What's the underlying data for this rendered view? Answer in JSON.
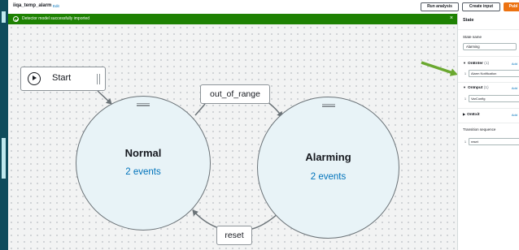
{
  "header": {
    "title": "iiqa_temp_alarm",
    "edit_label": "Edit",
    "buttons": {
      "run_analysis": "Run analysis",
      "create_input": "Create input",
      "publish": "Publ"
    }
  },
  "flash": {
    "message": "Detector model successfully imported",
    "close_glyph": "×"
  },
  "diagram": {
    "start_label": "Start",
    "states": [
      {
        "name": "Normal",
        "events": "2 events"
      },
      {
        "name": "Alarming",
        "events": "2 events"
      }
    ],
    "transitions": [
      {
        "label": "out_of_range"
      },
      {
        "label": "reset"
      }
    ]
  },
  "panel": {
    "title": "State",
    "state_name_label": "State name",
    "state_name_value": "Alarming",
    "sections": {
      "on_enter": {
        "label": "OnEnter",
        "count": "(1)",
        "add": "Add",
        "rows": [
          {
            "index": "1",
            "value": "Alarm Notification"
          }
        ]
      },
      "on_input": {
        "label": "OnInput",
        "count": "(1)",
        "add": "Add",
        "rows": [
          {
            "index": "1",
            "value": "VarConfig"
          }
        ]
      },
      "on_exit": {
        "label": "OnExit",
        "add": "Add"
      }
    },
    "transition_sequence_label": "Transition sequence",
    "transition_sequence_rows": [
      {
        "index": "1",
        "value": "reset"
      }
    ]
  },
  "colors": {
    "success": "#1d8102",
    "primary": "#ec7211",
    "link": "#0073bb",
    "annotation_arrow": "#6aa82f",
    "left_nav": "#0f4c5c"
  },
  "icons": {
    "play": "play-icon",
    "success": "check-circle-icon",
    "close": "close-icon",
    "drag": "drag-handle-icon"
  }
}
